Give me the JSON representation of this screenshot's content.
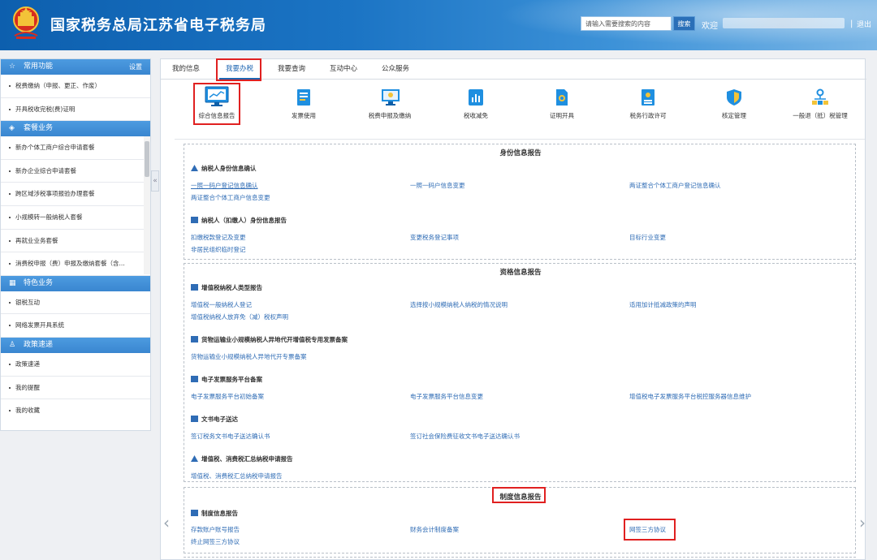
{
  "header": {
    "title": "国家税务总局江苏省电子税务局",
    "search_placeholder": "请输入需要搜索的内容",
    "search_button": "搜索",
    "welcome": "欢迎",
    "divider": "|",
    "logout": "退出"
  },
  "sidebar": {
    "groups": [
      {
        "title": "常用功能",
        "icon": "star-icon",
        "action": "设置",
        "items": [
          "税费缴纳（申报、更正、作废）",
          "开具税收完税(费)证明"
        ]
      },
      {
        "title": "套餐业务",
        "icon": "package-icon",
        "items": [
          "新办个体工商户综合申请套餐",
          "新办企业综合申请套餐",
          "跨区域涉税事项报验办理套餐",
          "小规模转一般纳税人套餐",
          "再就业业务套餐",
          "消费税申报（费）申报及缴纳套餐（含..."
        ]
      },
      {
        "title": "特色业务",
        "icon": "grid-icon",
        "items": [
          "银税互动",
          "网络发票开具系统"
        ]
      },
      {
        "title": "政策速递",
        "icon": "user-icon",
        "items": [
          "政策速递",
          "我的提醒",
          "我的收藏"
        ]
      }
    ],
    "collapse_label": "«"
  },
  "tabs": [
    "我的信息",
    "我要办税",
    "我要查询",
    "互动中心",
    "公众服务"
  ],
  "active_tab": "我要办税",
  "functions": [
    {
      "label": "综合信息报告",
      "icon": "monitor-chart-icon"
    },
    {
      "label": "发票使用",
      "icon": "invoice-icon"
    },
    {
      "label": "税费申报及缴纳",
      "icon": "screen-icon"
    },
    {
      "label": "税收减免",
      "icon": "chart-doc-icon"
    },
    {
      "label": "证明开具",
      "icon": "certificate-icon"
    },
    {
      "label": "税务行政许可",
      "icon": "license-icon"
    },
    {
      "label": "核定管理",
      "icon": "shield-icon"
    },
    {
      "label": "一般退（抵）税管理",
      "icon": "flow-icon"
    }
  ],
  "sections": {
    "identity": {
      "title": "身份信息报告",
      "sub1": "纳税人身份信息确认",
      "sub1_links": [
        "一照一码户登记信息确认",
        "一照一码户信息变更",
        "两证整合个体工商户登记信息确认",
        "两证整合个体工商户信息变更"
      ],
      "sub2": "纳税人（扣缴人）身份信息报告",
      "sub2_links": [
        "扣缴税款登记及变更",
        "变更税务登记事项",
        "目标行业变更",
        "非居民组织临时登记"
      ]
    },
    "qualification": {
      "title": "资格信息报告",
      "sub1": "增值税纳税人类型报告",
      "sub1_links": [
        "增值税一般纳税人登记",
        "选择按小规模纳税人纳税的情况说明",
        "适用加计抵减政策的声明",
        "增值税纳税人放弃免（减）税权声明"
      ],
      "sub2": "货物运输业小规模纳税人异地代开增值税专用发票备案",
      "sub2_links": [
        "货物运输业小规模纳税人异地代开专票备案"
      ],
      "sub3": "电子发票服务平台备案",
      "sub3_links": [
        "电子发票服务平台初始备案",
        "电子发票服务平台信息变更",
        "增值税电子发票服务平台税控服务器信息维护"
      ],
      "sub4": "文书电子送达",
      "sub4_links": [
        "签订税务文书电子送达确认书",
        "签订社会保险费征收文书电子送达确认书"
      ],
      "sub5": "增值税、消费税汇总纳税申请报告",
      "sub5_links": [
        "增值税、消费税汇总纳税申请报告"
      ]
    },
    "institution": {
      "title": "制度信息报告",
      "sub1": "制度信息报告",
      "sub1_links": [
        "存款账户账号报告",
        "财务会计制度备案",
        "网签三方协议",
        "终止网签三方协议"
      ]
    }
  },
  "nav_arrows": {
    "left": "‹",
    "right": "›"
  },
  "colors": {
    "header": "#1b74c4",
    "link": "#2f6cb5",
    "highlight": "#e02020",
    "sidebar_head": "#4d9be0"
  }
}
